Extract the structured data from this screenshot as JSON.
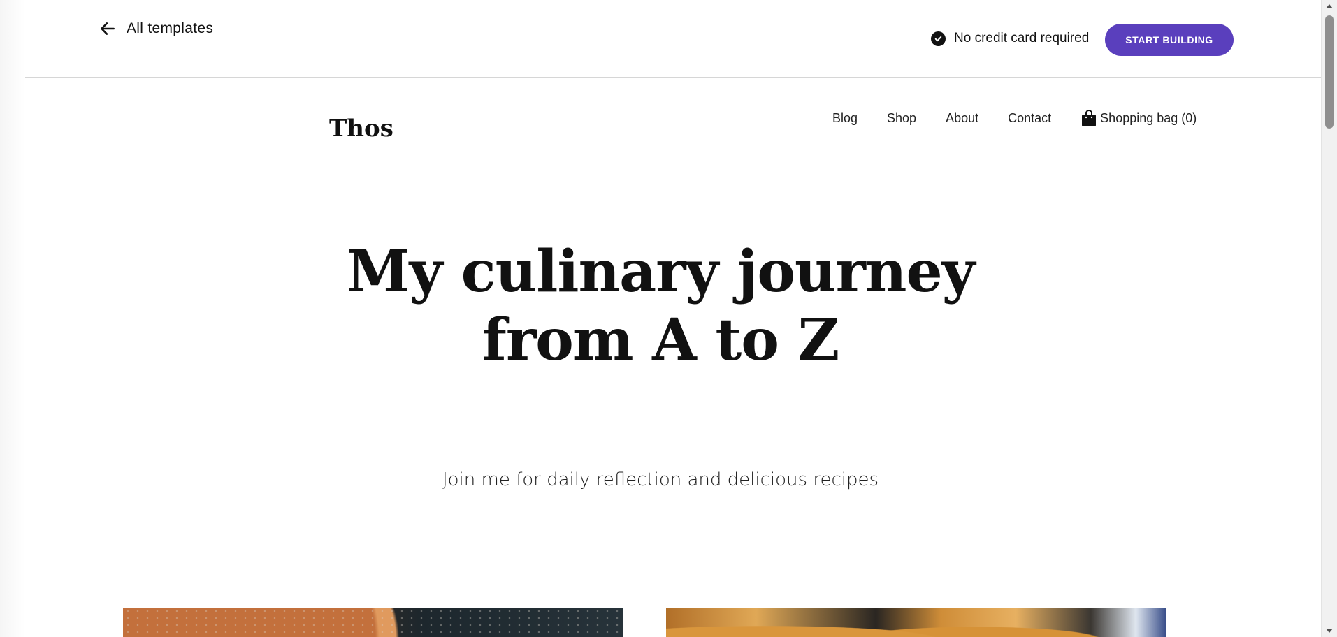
{
  "editor_bar": {
    "back_label": "All templates",
    "no_cc_label": "No credit card required",
    "cta_label": "START BUILDING",
    "cta_color": "#5a3fbd"
  },
  "site": {
    "logo": "Thos",
    "nav": {
      "blog": "Blog",
      "shop": "Shop",
      "about": "About",
      "contact": "Contact",
      "bag": "Shopping bag (0)"
    },
    "hero": {
      "title_line1": "My culinary journey",
      "title_line2": "from A to Z",
      "subtitle": "Join me for daily reflection and delicious recipes"
    }
  },
  "icons": {
    "back": "arrow-left-icon",
    "check": "check-circle-icon",
    "bag": "shopping-bag-icon"
  }
}
